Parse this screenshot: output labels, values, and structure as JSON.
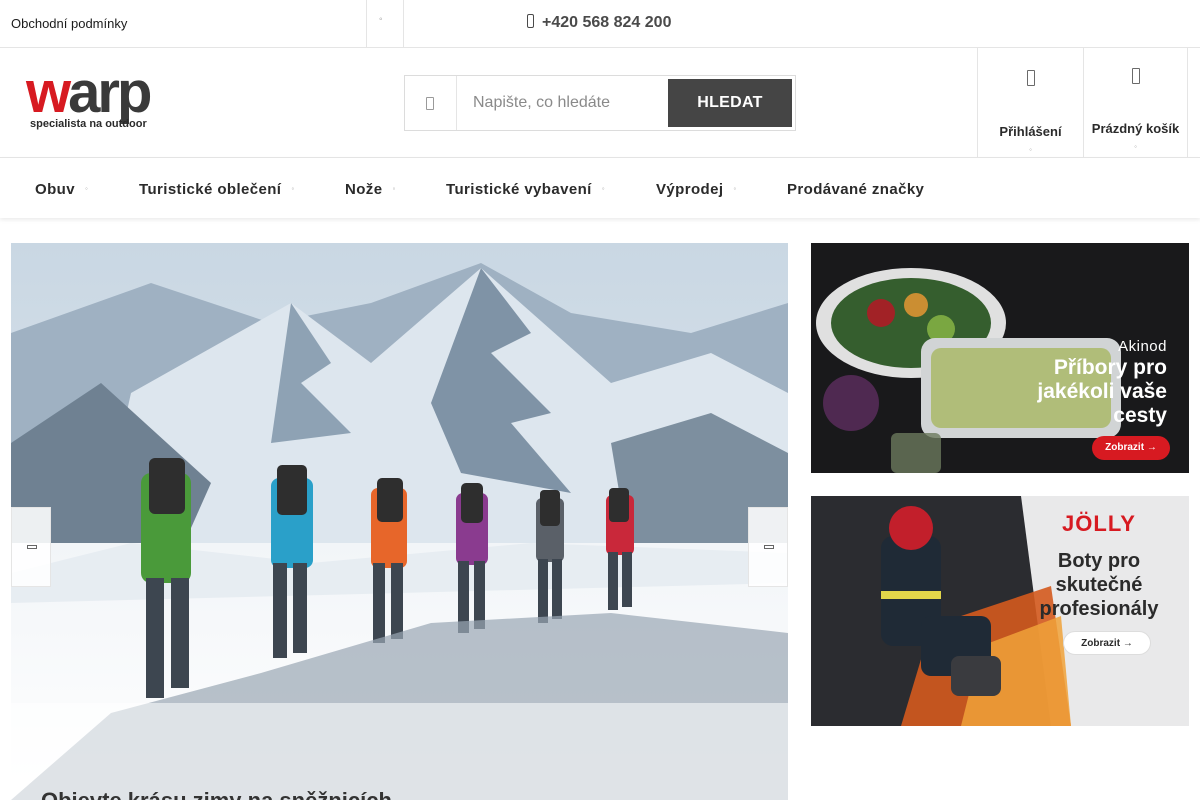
{
  "topbar": {
    "terms_link": "Obchodní podmínky",
    "phone": "+420 568 824 200"
  },
  "logo": {
    "word_w": "w",
    "word_rest": "arp",
    "tagline": "specialista na outdoor"
  },
  "search": {
    "placeholder": "Napište, co hledáte",
    "button_label": "HLEDAT"
  },
  "account": {
    "login_label": "Přihlášení",
    "cart_label": "Prázdný košík"
  },
  "nav": {
    "items": [
      {
        "label": "Obuv"
      },
      {
        "label": "Turistické oblečení"
      },
      {
        "label": "Nože"
      },
      {
        "label": "Turistické vybavení"
      },
      {
        "label": "Výprodej"
      },
      {
        "label": "Prodávané značky"
      }
    ]
  },
  "hero": {
    "caption": "Objevte krásu zimy na sněžnicích"
  },
  "banners": [
    {
      "brand": "Akinod",
      "lines": [
        "Příbory pro",
        "jakékoli vaše",
        "cesty"
      ],
      "button": "Zobrazit →"
    },
    {
      "brand": "JÖLLY",
      "lines": [
        "Boty pro",
        "skutečné",
        "profesionály"
      ],
      "button": "Zobrazit →"
    }
  ],
  "colors": {
    "brand_red": "#d71a21",
    "search_button": "#454545",
    "text": "#2b2b2b"
  },
  "icons": {
    "phone": "phone-icon",
    "search": "search-icon",
    "login": "user-icon",
    "cart": "cart-icon",
    "prev": "chevron-left-icon",
    "next": "chevron-right-icon"
  }
}
